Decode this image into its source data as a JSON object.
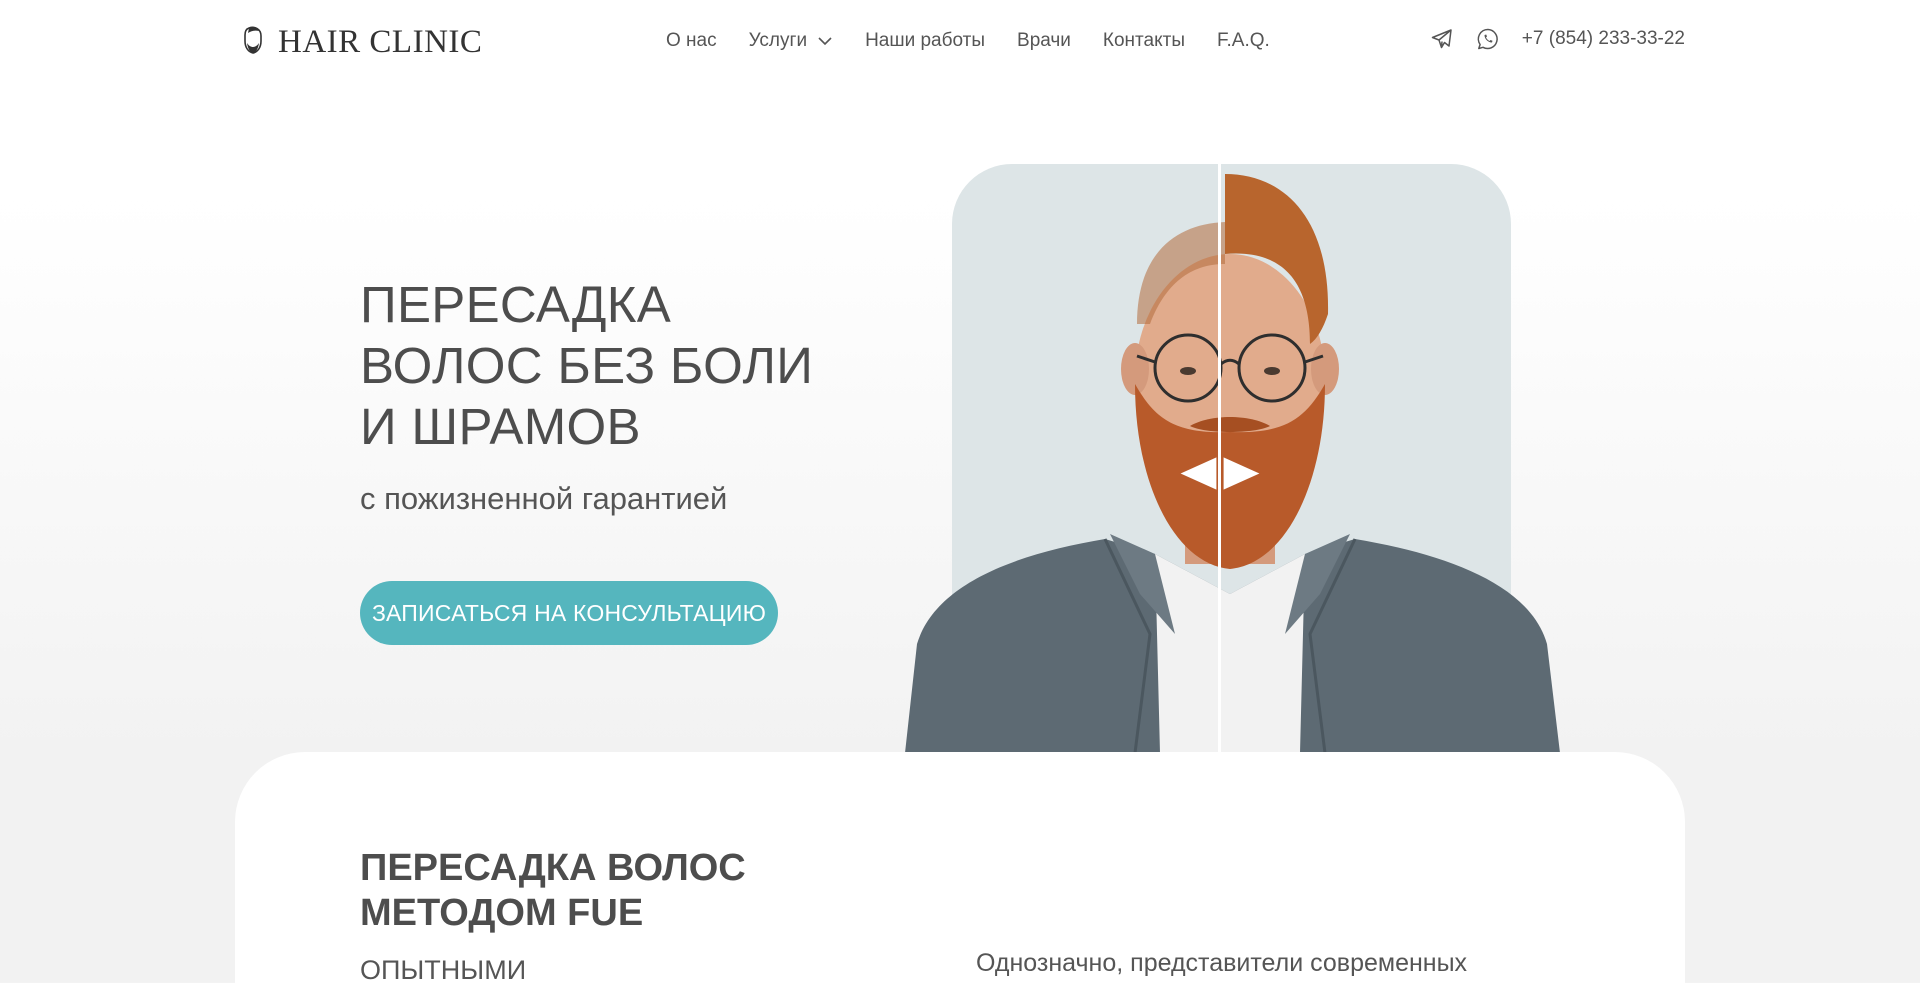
{
  "header": {
    "logo_text": "HAIR CLINIC",
    "nav": [
      {
        "label": "О нас"
      },
      {
        "label": "Услуги",
        "has_dropdown": true
      },
      {
        "label": "Наши работы"
      },
      {
        "label": "Врачи"
      },
      {
        "label": "Контакты"
      },
      {
        "label": "F.A.Q."
      }
    ],
    "icons": [
      "telegram-icon",
      "whatsapp-icon"
    ],
    "phone": "+7 (854) 233-33-22"
  },
  "hero": {
    "title": "ПЕРЕСАДКА ВОЛОС БЕЗ БОЛИ И ШРАМОВ",
    "subtitle": "с пожизненной гарантией",
    "cta_label": "ЗАПИСАТЬСЯ НА КОНСУЛЬТАЦИЮ",
    "compare_handle_icons": [
      "arrow-left-icon",
      "arrow-right-icon"
    ]
  },
  "section": {
    "title": "ПЕРЕСАДКА ВОЛОС МЕТОДОМ FUE",
    "subtitle": "ОПЫТНЫМИ",
    "text": "Однозначно, представители современных"
  },
  "colors": {
    "accent": "#55b6be",
    "text": "#4d4d4d",
    "image_background": "#dde5e7"
  }
}
